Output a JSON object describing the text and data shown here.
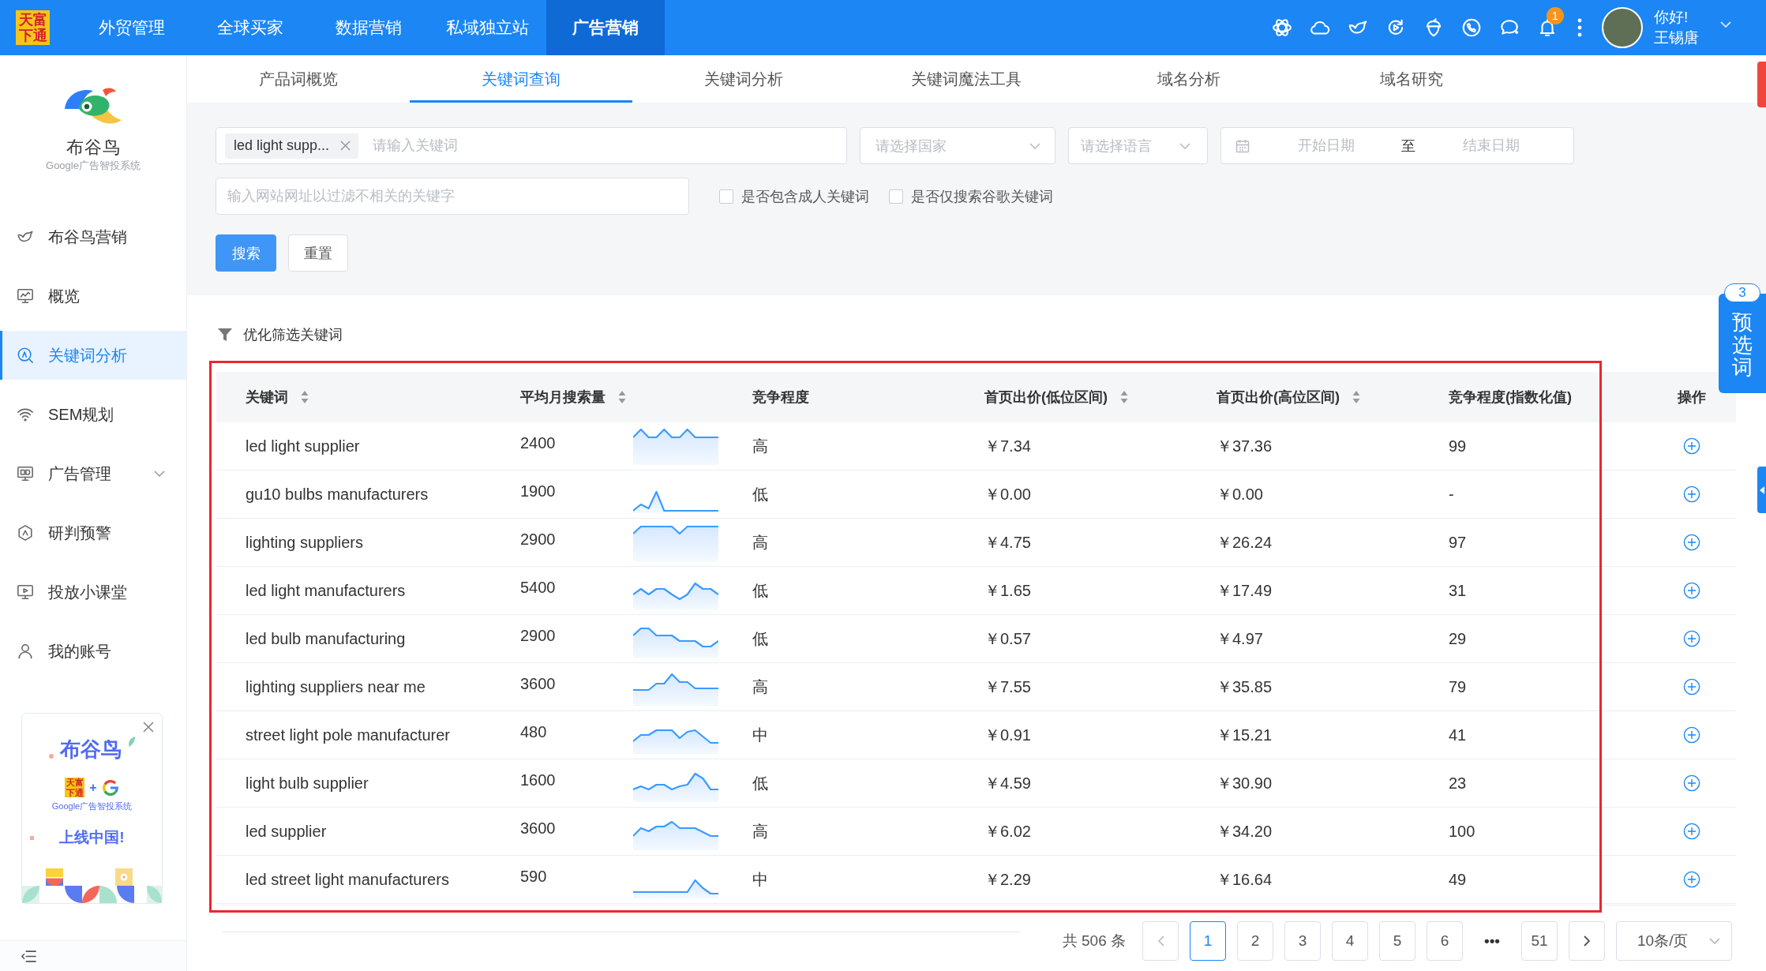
{
  "topbar": {
    "logo": "天富下通",
    "nav": [
      {
        "label": "外贸管理",
        "selected": false
      },
      {
        "label": "全球买家",
        "selected": false
      },
      {
        "label": "数据营销",
        "selected": false
      },
      {
        "label": "私域独立站",
        "selected": false
      },
      {
        "label": "广告营销",
        "selected": true
      }
    ],
    "notification_count": "1",
    "greeting": "你好!",
    "user_name": "王锡唐"
  },
  "sidebar": {
    "brand": "布谷鸟",
    "subtitle": "Google广告智投系统",
    "items": [
      {
        "label": "布谷鸟营销",
        "selected": false,
        "submenu": false
      },
      {
        "label": "概览",
        "selected": false,
        "submenu": false
      },
      {
        "label": "关键词分析",
        "selected": true,
        "submenu": false
      },
      {
        "label": "SEM规划",
        "selected": false,
        "submenu": false
      },
      {
        "label": "广告管理",
        "selected": false,
        "submenu": true
      },
      {
        "label": "研判预警",
        "selected": false,
        "submenu": false
      },
      {
        "label": "投放小课堂",
        "selected": false,
        "submenu": false
      },
      {
        "label": "我的账号",
        "selected": false,
        "submenu": false
      }
    ],
    "promo": {
      "title": "布谷鸟",
      "logo": "天富下通",
      "plus": "+",
      "subtitle": "Google广告智投系统",
      "slogan": "上线中国!"
    }
  },
  "tabs": [
    {
      "label": "产品词概览",
      "selected": false
    },
    {
      "label": "关键词查询",
      "selected": true
    },
    {
      "label": "关键词分析",
      "selected": false
    },
    {
      "label": "关键词魔法工具",
      "selected": false
    },
    {
      "label": "域名分析",
      "selected": false
    },
    {
      "label": "域名研究",
      "selected": false
    }
  ],
  "filters": {
    "keyword": {
      "tags": [
        "led light supp..."
      ],
      "placeholder": "请输入关键词"
    },
    "country": {
      "placeholder": "请选择国家"
    },
    "language": {
      "placeholder": "请选择语言"
    },
    "date_range": {
      "start_placeholder": "开始日期",
      "separator": "至",
      "end_placeholder": "结束日期"
    },
    "website": {
      "placeholder": "输入网站网址以过滤不相关的关键字"
    },
    "checkboxes": [
      {
        "label": "是否包含成人关键词",
        "checked": false
      },
      {
        "label": "是否仅搜索谷歌关键词",
        "checked": false
      }
    ],
    "buttons": [
      {
        "label": "搜索",
        "kind": "primary"
      },
      {
        "label": "重置",
        "kind": "default"
      }
    ]
  },
  "results": {
    "filter_label": "优化筛选关键词",
    "table": {
      "highlighted": true,
      "columns": [
        {
          "label": "关键词",
          "sortable": true
        },
        {
          "label": "平均月搜索量",
          "sortable": true
        },
        {
          "label": "竞争程度",
          "sortable": false
        },
        {
          "label": "首页出价(低位区间)",
          "sortable": true
        },
        {
          "label": "首页出价(高位区间)",
          "sortable": true
        },
        {
          "label": "竞争程度(指数化值)",
          "sortable": false
        },
        {
          "label": "操作",
          "sortable": false
        }
      ],
      "rows": [
        {
          "keyword": "led light supplier",
          "volume": "2400",
          "competition": "高",
          "bid_low": "￥7.34",
          "bid_high": "￥37.36",
          "competition_index": "99"
        },
        {
          "keyword": "gu10 bulbs manufacturers",
          "volume": "1900",
          "competition": "低",
          "bid_low": "￥0.00",
          "bid_high": "￥0.00",
          "competition_index": "-"
        },
        {
          "keyword": "lighting suppliers",
          "volume": "2900",
          "competition": "高",
          "bid_low": "￥4.75",
          "bid_high": "￥26.24",
          "competition_index": "97"
        },
        {
          "keyword": "led light manufacturers",
          "volume": "5400",
          "competition": "低",
          "bid_low": "￥1.65",
          "bid_high": "￥17.49",
          "competition_index": "31"
        },
        {
          "keyword": "led bulb manufacturing",
          "volume": "2900",
          "competition": "低",
          "bid_low": "￥0.57",
          "bid_high": "￥4.97",
          "competition_index": "29"
        },
        {
          "keyword": "lighting suppliers near me",
          "volume": "3600",
          "competition": "高",
          "bid_low": "￥7.55",
          "bid_high": "￥35.85",
          "competition_index": "79"
        },
        {
          "keyword": "street light pole manufacturer",
          "volume": "480",
          "competition": "中",
          "bid_low": "￥0.91",
          "bid_high": "￥15.21",
          "competition_index": "41"
        },
        {
          "keyword": "light bulb supplier",
          "volume": "1600",
          "competition": "低",
          "bid_low": "￥4.59",
          "bid_high": "￥30.90",
          "competition_index": "23"
        },
        {
          "keyword": "led supplier",
          "volume": "3600",
          "competition": "高",
          "bid_low": "￥6.02",
          "bid_high": "￥34.20",
          "competition_index": "100"
        },
        {
          "keyword": "led street light manufacturers",
          "volume": "590",
          "competition": "中",
          "bid_low": "￥2.29",
          "bid_high": "￥16.64",
          "competition_index": "49"
        }
      ]
    },
    "pagination": {
      "total": "共 506 条",
      "prev_disabled": true,
      "next_disabled": false,
      "pages": [
        {
          "label": "1",
          "kind": "page",
          "selected": true
        },
        {
          "label": "2",
          "kind": "page",
          "selected": false
        },
        {
          "label": "3",
          "kind": "page",
          "selected": false
        },
        {
          "label": "4",
          "kind": "page",
          "selected": false
        },
        {
          "label": "5",
          "kind": "page",
          "selected": false
        },
        {
          "label": "6",
          "kind": "page",
          "selected": false
        },
        {
          "label": "•••",
          "kind": "ellipsis",
          "selected": false
        },
        {
          "label": "51",
          "kind": "page",
          "selected": false
        }
      ],
      "page_size": "10条/页"
    }
  },
  "preselect": {
    "label": "预选词",
    "count": "3"
  }
}
